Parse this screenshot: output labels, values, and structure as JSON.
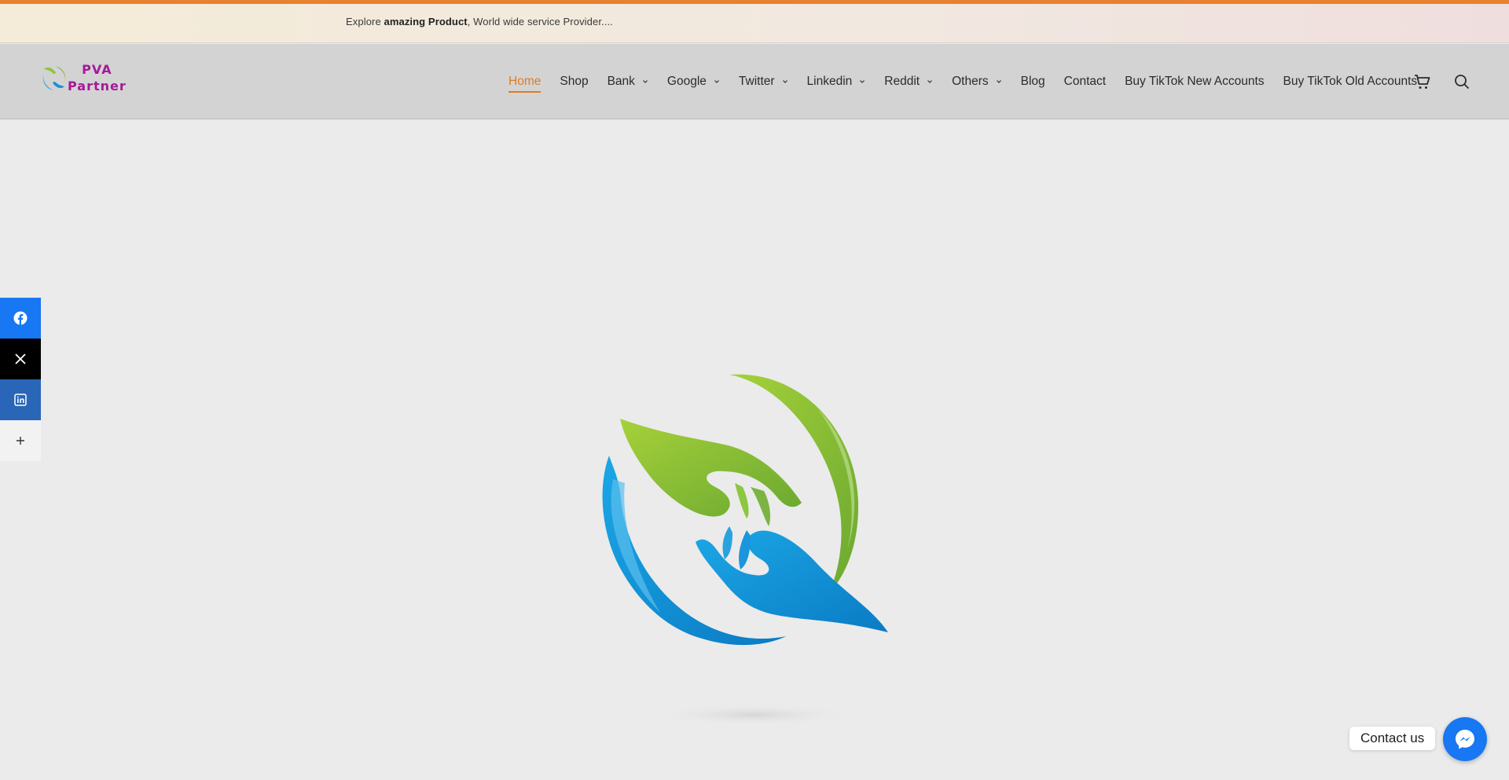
{
  "topbar": {
    "promo_prefix": "Explore ",
    "promo_bold": "amazing Product",
    "promo_suffix": ", World wide service Provider...."
  },
  "header": {
    "logo": {
      "line1": "PVA",
      "line2": "Partner"
    },
    "nav": [
      {
        "label": "Home",
        "active": true,
        "dropdown": false
      },
      {
        "label": "Shop",
        "active": false,
        "dropdown": false
      },
      {
        "label": "Bank",
        "active": false,
        "dropdown": true
      },
      {
        "label": "Google",
        "active": false,
        "dropdown": true
      },
      {
        "label": "Twitter",
        "active": false,
        "dropdown": true
      },
      {
        "label": "Linkedin",
        "active": false,
        "dropdown": true
      },
      {
        "label": "Reddit",
        "active": false,
        "dropdown": true
      },
      {
        "label": "Others",
        "active": false,
        "dropdown": true
      },
      {
        "label": "Blog",
        "active": false,
        "dropdown": false
      },
      {
        "label": "Contact",
        "active": false,
        "dropdown": false
      },
      {
        "label": "Buy TikTok New Accounts",
        "active": false,
        "dropdown": false
      },
      {
        "label": "Buy TikTok Old Accounts",
        "active": false,
        "dropdown": false
      }
    ],
    "icons": [
      "cart-icon",
      "search-icon"
    ]
  },
  "social_share": [
    "facebook-icon",
    "x-icon",
    "linkedin-icon",
    "plus-icon"
  ],
  "contact": {
    "label": "Contact us",
    "icon": "messenger-icon"
  },
  "colors": {
    "accent": "#e07b22",
    "header_bg": "#d3d3d3",
    "facebook": "#1877f2",
    "linkedin": "#2a66b7",
    "brand_purple": "#a4199a"
  }
}
